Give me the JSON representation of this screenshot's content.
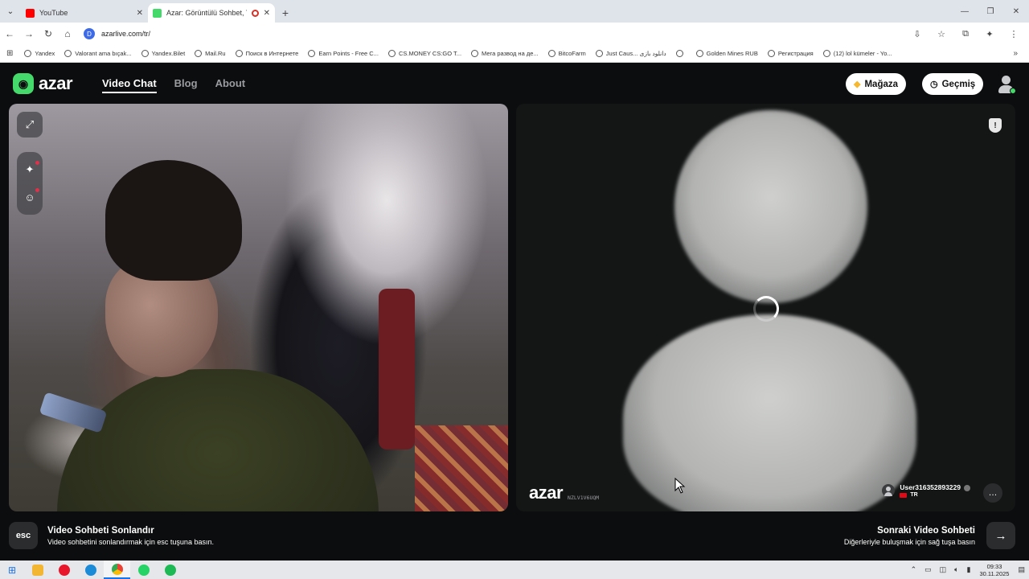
{
  "browser": {
    "tabs": [
      {
        "title": "YouTube",
        "favicon_color": "#ff0000",
        "active": false
      },
      {
        "title": "Azar: Görüntülü Sohbet, Ye",
        "favicon_color": "#45d96b",
        "active": true,
        "recording": true
      }
    ],
    "url": "azarlive.com/tr/",
    "bookmarks": [
      "Yandex",
      "Valorant ama bıçak...",
      "Yandex.Bilet",
      "Mail.Ru",
      "Поиск в Интернете",
      "Earn Points - Free C...",
      "CS.MONEY CS:GO T...",
      "Мега развод на де...",
      "BitcoFarm",
      "Just Caus... دانلود بازی",
      "",
      "Golden Mines RUB",
      "Регистрация",
      "(12) lol kümeler - Yo..."
    ]
  },
  "azar": {
    "logo": "azar",
    "nav": [
      {
        "label": "Video Chat",
        "active": true
      },
      {
        "label": "Blog",
        "active": false
      },
      {
        "label": "About",
        "active": false
      }
    ],
    "store_button": "Mağaza",
    "history_button": "Geçmiş",
    "remote": {
      "watermark": "azar",
      "watermark_code": "NZLV1V6UQM",
      "peer_name": "User316352893229",
      "peer_country": "TR"
    },
    "footer": {
      "esc_key": "esc",
      "end_title": "Video Sohbeti Sonlandır",
      "end_subtitle": "Video sohbetini sonlandırmak için esc tuşuna basın.",
      "next_title": "Sonraki Video Sohbeti",
      "next_subtitle": "Diğerleriyle buluşmak için sağ tuşa basın"
    }
  },
  "taskbar": {
    "time": "09:33",
    "date": "30.11.2025",
    "apps": [
      {
        "name": "file-explorer",
        "color": "#f2b632"
      },
      {
        "name": "opera",
        "color": "#e8172c"
      },
      {
        "name": "edge",
        "color": "#1b8bd8"
      },
      {
        "name": "chrome",
        "color": "#34a853"
      },
      {
        "name": "whatsapp",
        "color": "#25d366"
      },
      {
        "name": "spotify",
        "color": "#1db954"
      }
    ]
  },
  "colors": {
    "accent": "#45d96b",
    "page_bg": "#0c0d0e"
  }
}
